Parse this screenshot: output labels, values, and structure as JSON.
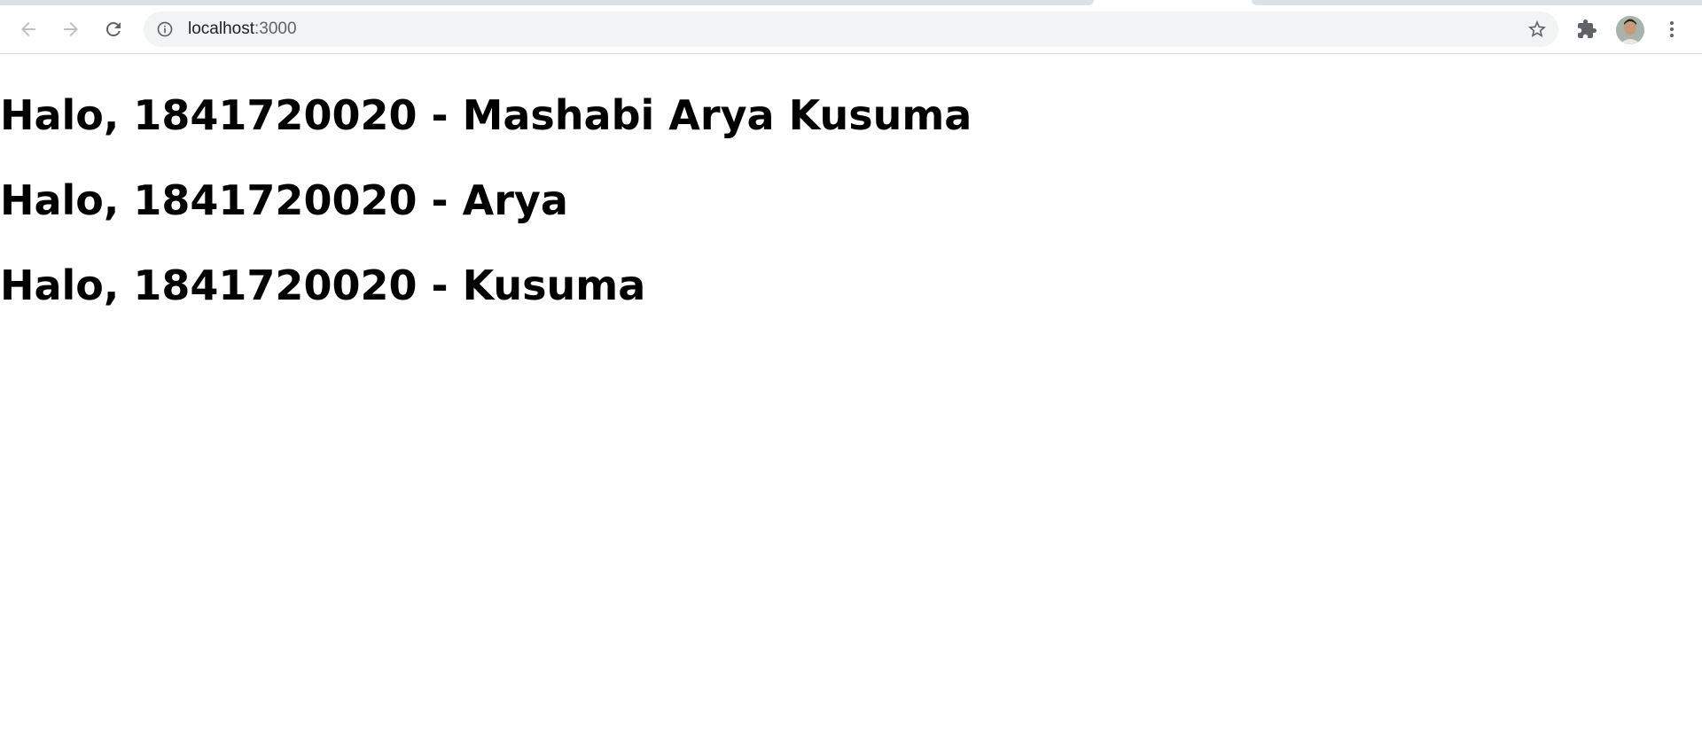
{
  "browser": {
    "url_host": "localhost",
    "url_port": ":3000",
    "icons": {
      "back": "arrow-left-icon",
      "forward": "arrow-right-icon",
      "reload": "reload-icon",
      "site_info": "info-icon",
      "bookmark": "star-icon",
      "extensions": "puzzle-icon",
      "menu": "kebab-menu-icon"
    },
    "colors": {
      "toolbar_bg": "#ffffff",
      "omnibox_bg": "#f1f3f4",
      "tabstrip_bg": "#dee1e6",
      "icon_color": "#5f6368",
      "disabled_icon_color": "#bdc1c6"
    }
  },
  "page": {
    "greetings": [
      "Halo, 1841720020 - Mashabi Arya Kusuma",
      "Halo, 1841720020 - Arya",
      "Halo, 1841720020 - Kusuma"
    ]
  }
}
